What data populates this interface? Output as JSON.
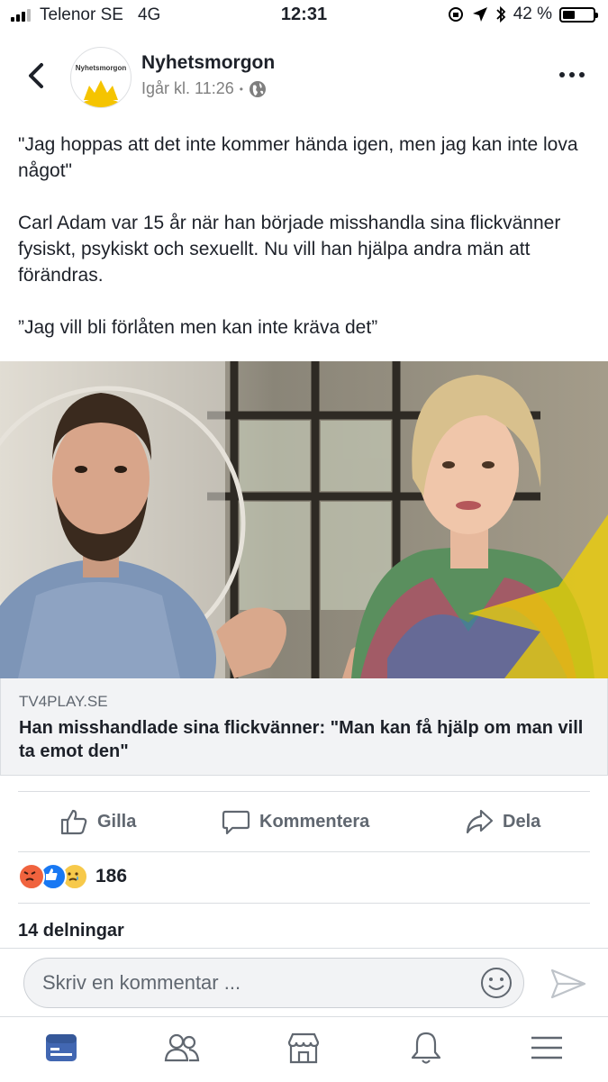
{
  "status_bar": {
    "carrier": "Telenor SE",
    "network": "4G",
    "time": "12:31",
    "battery_percent": "42 %",
    "battery_level": 0.42
  },
  "post_header": {
    "page_name": "Nyhetsmorgon",
    "avatar_text": "Nyhetsmorgon",
    "timestamp": "Igår kl. 11:26",
    "separator": "•",
    "audience_icon": "globe-icon"
  },
  "post": {
    "paragraphs": [
      "\"Jag hoppas att det inte kommer hända igen, men jag kan inte lova något\"",
      "Carl Adam var 15 år när han började misshandla sina flickvänner fysiskt, psykiskt och sexuellt. Nu vill han hjälpa andra män att förändras.",
      "”Jag vill bli förlåten men kan inte kräva det”"
    ]
  },
  "link_preview": {
    "domain": "TV4PLAY.SE",
    "title": "Han misshandlade sina flickvänner: \"Man kan få hjälp om man vill ta emot den\""
  },
  "actions": {
    "like": "Gilla",
    "comment": "Kommentera",
    "share": "Dela"
  },
  "reactions": {
    "types": [
      "angry",
      "like",
      "sad"
    ],
    "count": "186"
  },
  "shares": "14 delningar",
  "comment_box": {
    "placeholder": "Skriv en kommentar ..."
  },
  "tab_bar": {
    "items": [
      "news-feed-icon",
      "friends-icon",
      "marketplace-icon",
      "notifications-icon",
      "menu-icon"
    ],
    "active_index": 0
  },
  "colors": {
    "accent": "#4267b2",
    "text": "#1d2129",
    "secondary_text": "#606770",
    "link_bg": "#f2f3f5"
  }
}
